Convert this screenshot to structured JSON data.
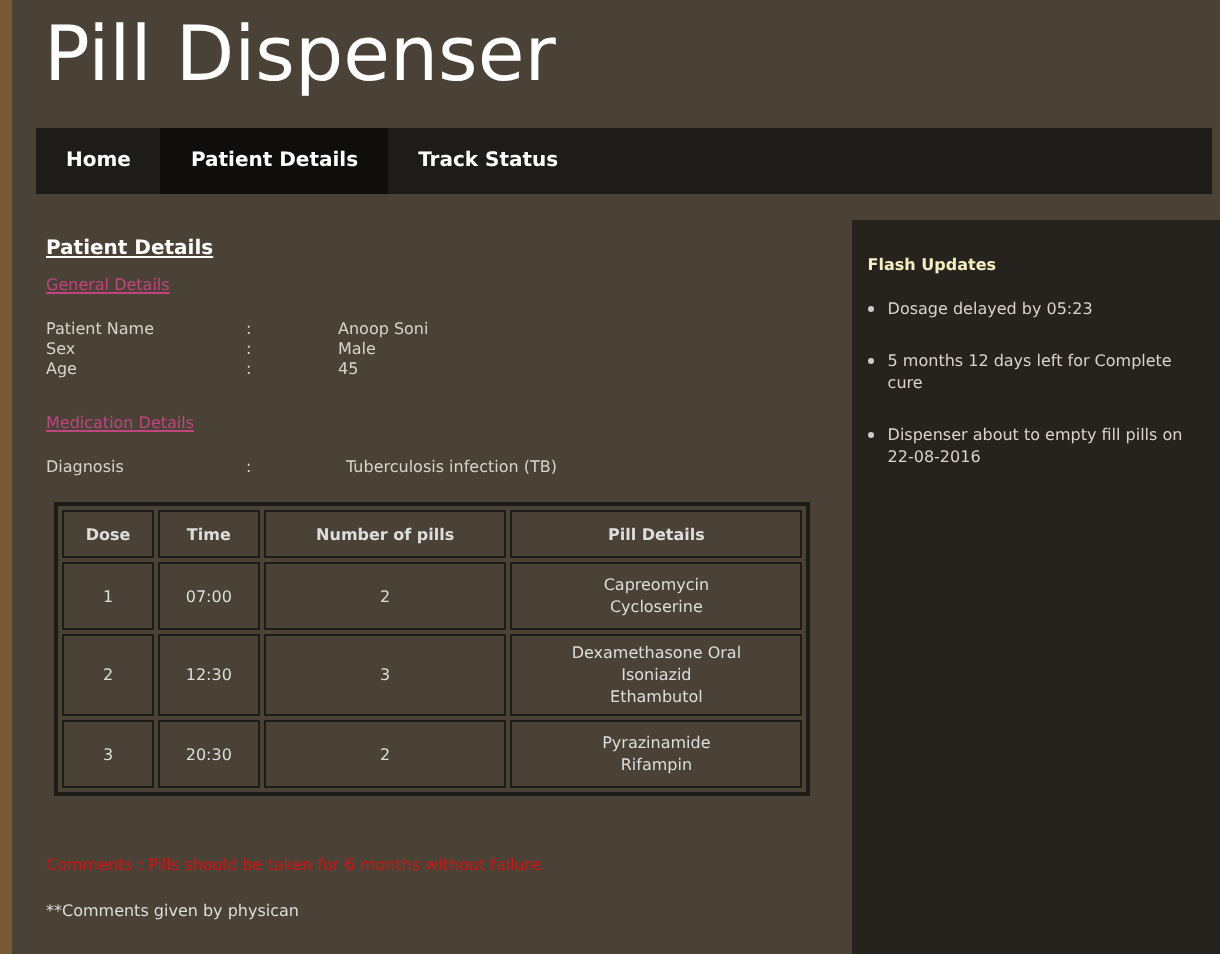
{
  "title": "Pill Dispenser",
  "nav": [
    {
      "label": "Home",
      "selected": false
    },
    {
      "label": "Patient Details",
      "selected": true
    },
    {
      "label": "Track Status",
      "selected": false
    }
  ],
  "heading": "Patient Details",
  "general": {
    "title": "General Details",
    "fields": [
      {
        "label": "Patient Name",
        "value": "Anoop Soni"
      },
      {
        "label": "Sex",
        "value": "Male"
      },
      {
        "label": "Age",
        "value": "45"
      }
    ]
  },
  "medication": {
    "title": "Medication Details",
    "fields": [
      {
        "label": "Diagnosis",
        "value": "Tuberculosis infection (TB)"
      }
    ]
  },
  "separator": ":",
  "table": {
    "columns": [
      "Dose",
      "Time",
      "Number of pills",
      "Pill Details"
    ],
    "rows": [
      {
        "dose": "1",
        "time": "07:00",
        "pills": "2",
        "details": [
          "Capreomycin",
          "Cycloserine"
        ]
      },
      {
        "dose": "2",
        "time": "12:30",
        "pills": "3",
        "details": [
          "Dexamethasone Oral",
          "Isoniazid",
          "Ethambutol"
        ]
      },
      {
        "dose": "3",
        "time": "20:30",
        "pills": "2",
        "details": [
          "Pyrazinamide",
          "Rifampin"
        ]
      }
    ]
  },
  "comment": "Comments :  Pills should be taken for 6 months without failure.",
  "footnote": "**Comments given by physican",
  "sidebar": {
    "title": "Flash Updates",
    "items": [
      "Dosage delayed by 05:23",
      "5 months 12 days left for Complete cure",
      "Dispenser about to empty fill pills on 22-08-2016"
    ]
  }
}
